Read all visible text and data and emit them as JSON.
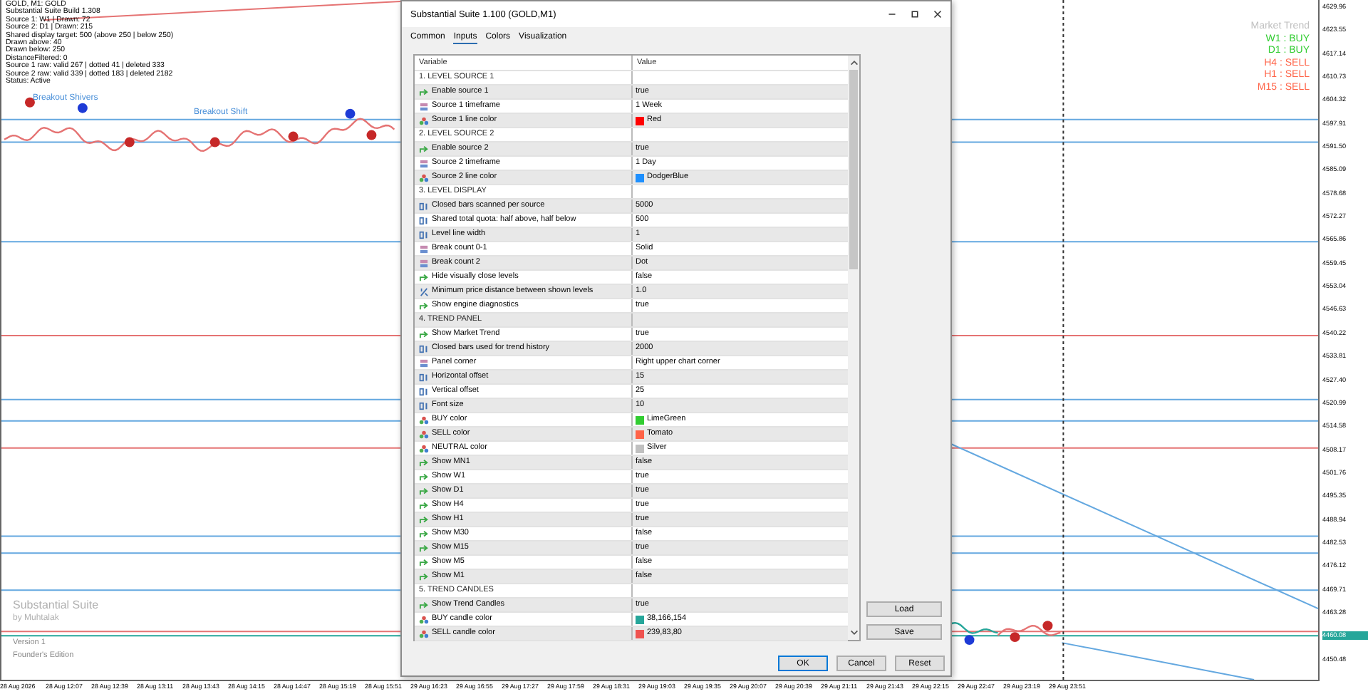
{
  "chart": {
    "info_lines": [
      "GOLD, M1: GOLD",
      "Substantial Suite Build 1.308",
      "Source 1: W1 | Drawn: 72",
      "Source 2: D1 | Drawn: 215",
      "Shared display target: 500 (above 250 | below 250)",
      "Drawn above: 40",
      "Drawn below: 250",
      "DistanceFiltered: 0",
      "Source 1 raw: valid 267 | dotted 41 | deleted 333",
      "Source 2 raw: valid 339 | dotted 183 | deleted 2182",
      "Status: Active"
    ],
    "level_labels": [
      "Breakout Shivers",
      "Breakout Shift"
    ],
    "trend_panel": {
      "title": "Market Trend",
      "items": [
        {
          "label": "W1 : BUY",
          "color": "#32cd32"
        },
        {
          "label": "D1 : BUY",
          "color": "#32cd32"
        },
        {
          "label": "H4 : SELL",
          "color": "#ff6347"
        },
        {
          "label": "H1 : SELL",
          "color": "#ff6347"
        },
        {
          "label": "M15 : SELL",
          "color": "#ff6347"
        }
      ]
    },
    "watermark": {
      "title": "Substantial Suite",
      "author": "by Muhtalak",
      "version": "Version 1",
      "edition": "Founder's Edition"
    },
    "price_axis": [
      {
        "label": "4629.96",
        "current": false
      },
      {
        "label": "4623.55",
        "current": false
      },
      {
        "label": "4617.14",
        "current": false
      },
      {
        "label": "4610.73",
        "current": false
      },
      {
        "label": "4604.32",
        "current": false
      },
      {
        "label": "4597.91",
        "current": false
      },
      {
        "label": "4591.50",
        "current": false
      },
      {
        "label": "4585.09",
        "current": false
      },
      {
        "label": "4578.68",
        "current": false
      },
      {
        "label": "4572.27",
        "current": false
      },
      {
        "label": "4565.86",
        "current": false
      },
      {
        "label": "4559.45",
        "current": false
      },
      {
        "label": "4553.04",
        "current": false
      },
      {
        "label": "4546.63",
        "current": false
      },
      {
        "label": "4540.22",
        "current": false
      },
      {
        "label": "4533.81",
        "current": false
      },
      {
        "label": "4527.40",
        "current": false
      },
      {
        "label": "4520.99",
        "current": false
      },
      {
        "label": "4514.58",
        "current": false
      },
      {
        "label": "4508.17",
        "current": false
      },
      {
        "label": "4501.76",
        "current": false
      },
      {
        "label": "4495.35",
        "current": false
      },
      {
        "label": "4488.94",
        "current": false
      },
      {
        "label": "4482.53",
        "current": false
      },
      {
        "label": "4476.12",
        "current": false
      },
      {
        "label": "4469.71",
        "current": false
      },
      {
        "label": "4463.28",
        "current": false
      },
      {
        "label": "4460.08",
        "current": true
      },
      {
        "label": "4450.48",
        "current": false
      }
    ],
    "time_axis": [
      "28 Aug 2026",
      "28 Aug 12:07",
      "28 Aug 12:39",
      "28 Aug 13:11",
      "28 Aug 13:43",
      "28 Aug 14:15",
      "28 Aug 14:47",
      "28 Aug 15:19",
      "28 Aug 15:51",
      "29 Aug 16:23",
      "29 Aug 16:55",
      "29 Aug 17:27",
      "29 Aug 17:59",
      "29 Aug 18:31",
      "29 Aug 19:03",
      "29 Aug 19:35",
      "29 Aug 20:07",
      "29 Aug 20:39",
      "29 Aug 21:11",
      "29 Aug 21:43",
      "29 Aug 22:15",
      "29 Aug 22:47",
      "29 Aug 23:19",
      "29 Aug 23:51"
    ]
  },
  "dialog": {
    "title": "Substantial Suite 1.100 (GOLD,M1)",
    "tabs": [
      {
        "label": "Common",
        "selected": false
      },
      {
        "label": "Inputs",
        "selected": true
      },
      {
        "label": "Colors",
        "selected": false
      },
      {
        "label": "Visualization",
        "selected": false
      }
    ],
    "columns": [
      "Variable",
      "Value"
    ],
    "rows": [
      {
        "kind": "section",
        "variable": "1. LEVEL SOURCE 1"
      },
      {
        "kind": "bool",
        "variable": "Enable source 1",
        "value": "true"
      },
      {
        "kind": "enum",
        "variable": "Source 1 timeframe",
        "value": "1 Week"
      },
      {
        "kind": "color",
        "variable": "Source 1 line color",
        "value": "Red",
        "color": "#ff0000"
      },
      {
        "kind": "section",
        "variable": "2. LEVEL SOURCE 2"
      },
      {
        "kind": "bool",
        "variable": "Enable source 2",
        "value": "true"
      },
      {
        "kind": "enum",
        "variable": "Source 2 timeframe",
        "value": "1 Day"
      },
      {
        "kind": "color",
        "variable": "Source 2 line color",
        "value": "DodgerBlue",
        "color": "#1e90ff"
      },
      {
        "kind": "section",
        "variable": "3. LEVEL DISPLAY"
      },
      {
        "kind": "int",
        "variable": "Closed bars scanned per source",
        "value": "5000"
      },
      {
        "kind": "int",
        "variable": "Shared total quota: half above, half below",
        "value": "500"
      },
      {
        "kind": "int",
        "variable": "Level line width",
        "value": "1"
      },
      {
        "kind": "enum",
        "variable": "Break count 0-1",
        "value": "Solid"
      },
      {
        "kind": "enum",
        "variable": "Break count 2",
        "value": "Dot"
      },
      {
        "kind": "bool",
        "variable": "Hide visually close levels",
        "value": "false"
      },
      {
        "kind": "double",
        "variable": "Minimum price distance between shown levels",
        "value": "1.0"
      },
      {
        "kind": "bool",
        "variable": "Show engine diagnostics",
        "value": "true"
      },
      {
        "kind": "section",
        "variable": "4. TREND PANEL"
      },
      {
        "kind": "bool",
        "variable": "Show Market Trend",
        "value": "true"
      },
      {
        "kind": "int",
        "variable": "Closed bars used for trend history",
        "value": "2000"
      },
      {
        "kind": "enum",
        "variable": "Panel corner",
        "value": "Right upper chart corner"
      },
      {
        "kind": "int",
        "variable": "Horizontal offset",
        "value": "15"
      },
      {
        "kind": "int",
        "variable": "Vertical offset",
        "value": "25"
      },
      {
        "kind": "int",
        "variable": "Font size",
        "value": "10"
      },
      {
        "kind": "color",
        "variable": "BUY color",
        "value": "LimeGreen",
        "color": "#32cd32"
      },
      {
        "kind": "color",
        "variable": "SELL color",
        "value": "Tomato",
        "color": "#ff6347"
      },
      {
        "kind": "color",
        "variable": "NEUTRAL color",
        "value": "Silver",
        "color": "#c0c0c0"
      },
      {
        "kind": "bool",
        "variable": "Show MN1",
        "value": "false"
      },
      {
        "kind": "bool",
        "variable": "Show W1",
        "value": "true"
      },
      {
        "kind": "bool",
        "variable": "Show D1",
        "value": "true"
      },
      {
        "kind": "bool",
        "variable": "Show H4",
        "value": "true"
      },
      {
        "kind": "bool",
        "variable": "Show H1",
        "value": "true"
      },
      {
        "kind": "bool",
        "variable": "Show M30",
        "value": "false"
      },
      {
        "kind": "bool",
        "variable": "Show M15",
        "value": "true"
      },
      {
        "kind": "bool",
        "variable": "Show M5",
        "value": "false"
      },
      {
        "kind": "bool",
        "variable": "Show M1",
        "value": "false"
      },
      {
        "kind": "section",
        "variable": "5. TREND CANDLES"
      },
      {
        "kind": "bool",
        "variable": "Show Trend Candles",
        "value": "true"
      },
      {
        "kind": "color",
        "variable": "BUY candle color",
        "value": "38,166,154",
        "color": "#26a69a"
      },
      {
        "kind": "color",
        "variable": "SELL candle color",
        "value": "239,83,80",
        "color": "#ef5350"
      }
    ],
    "side_buttons": [
      "Load",
      "Save"
    ],
    "buttons": [
      "OK",
      "Cancel",
      "Reset"
    ]
  }
}
